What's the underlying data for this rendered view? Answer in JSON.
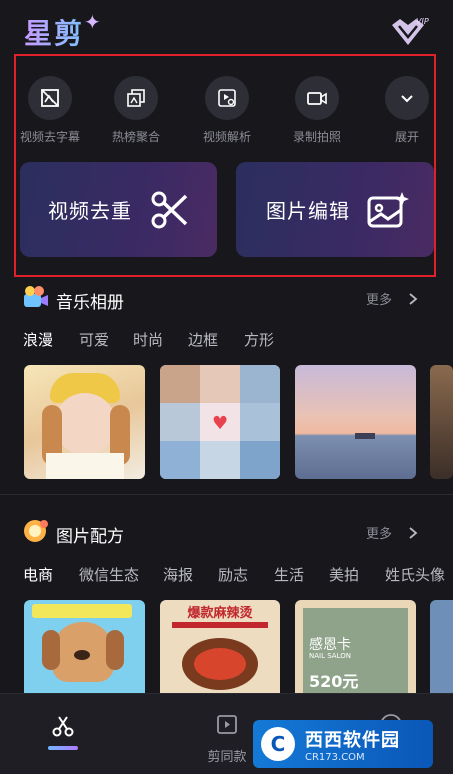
{
  "app": {
    "logo": "星剪",
    "vip_badge": "VIP"
  },
  "tools": [
    {
      "label": "视频去字幕",
      "icon": "picture-off-icon"
    },
    {
      "label": "热榜聚合",
      "icon": "stacked-images-icon"
    },
    {
      "label": "视频解析",
      "icon": "video-link-icon"
    },
    {
      "label": "录制拍照",
      "icon": "video-camera-icon"
    },
    {
      "label": "展开",
      "icon": "chevron-down-icon"
    }
  ],
  "big_buttons": [
    {
      "label": "视频去重",
      "icon": "scissors-icon"
    },
    {
      "label": "图片编辑",
      "icon": "image-edit-icon"
    }
  ],
  "music_album": {
    "title": "音乐相册",
    "more": "更多",
    "tabs": [
      "浪漫",
      "可爱",
      "时尚",
      "边框",
      "方形"
    ],
    "active_tab": 0
  },
  "photo_recipe": {
    "title": "图片配方",
    "more": "更多",
    "tabs": [
      "电商",
      "微信生态",
      "海报",
      "励志",
      "生活",
      "美拍",
      "姓氏头像"
    ],
    "active_tab": 0,
    "card_texts": [
      "爆款麻辣烫",
      "感恩卡",
      "NAIL SALON",
      "520元"
    ]
  },
  "bottom_nav": {
    "items": [
      "剪同款"
    ]
  },
  "watermark": {
    "brand": "西西软件园",
    "url": "CR173.COM"
  },
  "colors": {
    "highlight_border": "#e0202b",
    "accent": "#8e6bff"
  }
}
